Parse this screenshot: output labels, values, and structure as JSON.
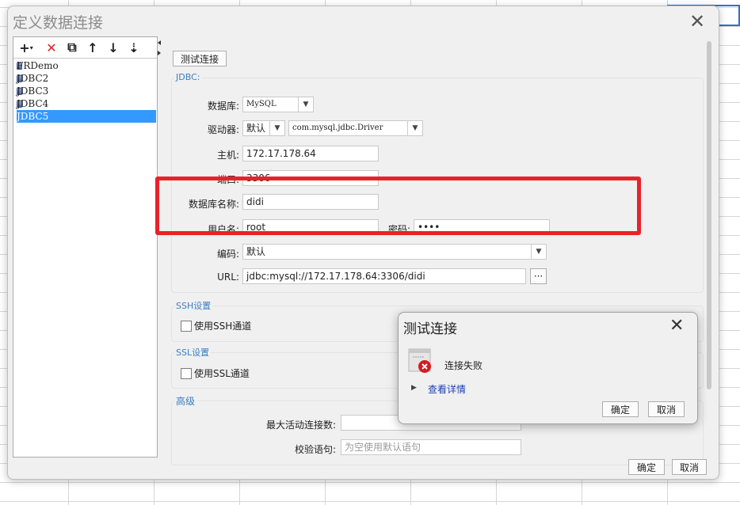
{
  "window": {
    "title": "定义数据连接",
    "close_glyph": "✕"
  },
  "toolbar": {
    "add": "+",
    "add_arrow": "▾",
    "delete": "✕",
    "copy": "⧉",
    "up": "↑",
    "down": "↓",
    "sort": "⇣"
  },
  "connections": [
    "FRDemo",
    "JDBC2",
    "JDBC3",
    "JDBC4",
    "JDBC5"
  ],
  "selected_connection": "JDBC5",
  "test_button": "测试连接",
  "jdbc": {
    "group_label": "JDBC:",
    "database_label": "数据库:",
    "database_value": "MySQL",
    "driver_label": "驱动器:",
    "driver_mode": "默认",
    "driver_class": "com.mysql.jdbc.Driver",
    "host_label": "主机:",
    "host_value": "172.17.178.64",
    "port_label": "端口:",
    "port_value": "3306",
    "dbname_label": "数据库名称:",
    "dbname_value": "didi",
    "user_label": "用户名:",
    "user_value": "root",
    "password_label": "密码:",
    "password_value": "••••",
    "encoding_label": "编码:",
    "encoding_value": "默认",
    "url_label": "URL:",
    "url_value": "jdbc:mysql://172.17.178.64:3306/didi",
    "url_button": "···"
  },
  "ssh": {
    "group_label": "SSH设置",
    "checkbox_label": "使用SSH通道"
  },
  "ssl": {
    "group_label": "SSL设置",
    "checkbox_label": "使用SSL通道"
  },
  "advanced": {
    "group_label": "高级",
    "max_active_label": "最大活动连接数:",
    "validation_label": "校验语句:",
    "validation_placeholder": "为空使用默认语句"
  },
  "footer": {
    "ok": "确定",
    "cancel": "取消"
  },
  "popup": {
    "title": "测试连接",
    "close_glyph": "✕",
    "message": "连接失败",
    "detail_toggle": "▶",
    "detail_link": "查看详情",
    "ok": "确定",
    "cancel": "取消"
  },
  "colors": {
    "accent": "#3a7fc0",
    "selection": "#3399ff",
    "error": "#e8222a",
    "link": "#1a3fb0"
  }
}
